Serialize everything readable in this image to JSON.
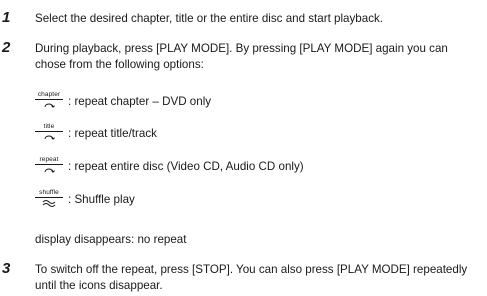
{
  "steps": [
    {
      "number": "1",
      "text": "Select the desired chapter, title or the entire disc and start playback."
    },
    {
      "number": "2",
      "text": "During playback, press [PLAY MODE]. By pressing [PLAY MODE] again you can chose from the following options:"
    },
    {
      "number": "3",
      "text": "To switch off the repeat, press [STOP]. You can also press [PLAY MODE] repeatedly until the icons disappear."
    }
  ],
  "options": [
    {
      "icon_label": "chapter",
      "icon": "repeat-icon",
      "description": ": repeat chapter – DVD only"
    },
    {
      "icon_label": "title",
      "icon": "repeat-icon",
      "description": ": repeat title/track"
    },
    {
      "icon_label": "repeat",
      "icon": "repeat-icon",
      "description": ": repeat entire disc (Video CD, Audio CD only)"
    },
    {
      "icon_label": "shuffle",
      "icon": "shuffle-icon",
      "description": ": Shuffle play"
    }
  ],
  "no_repeat_note": "display disappears: no repeat"
}
